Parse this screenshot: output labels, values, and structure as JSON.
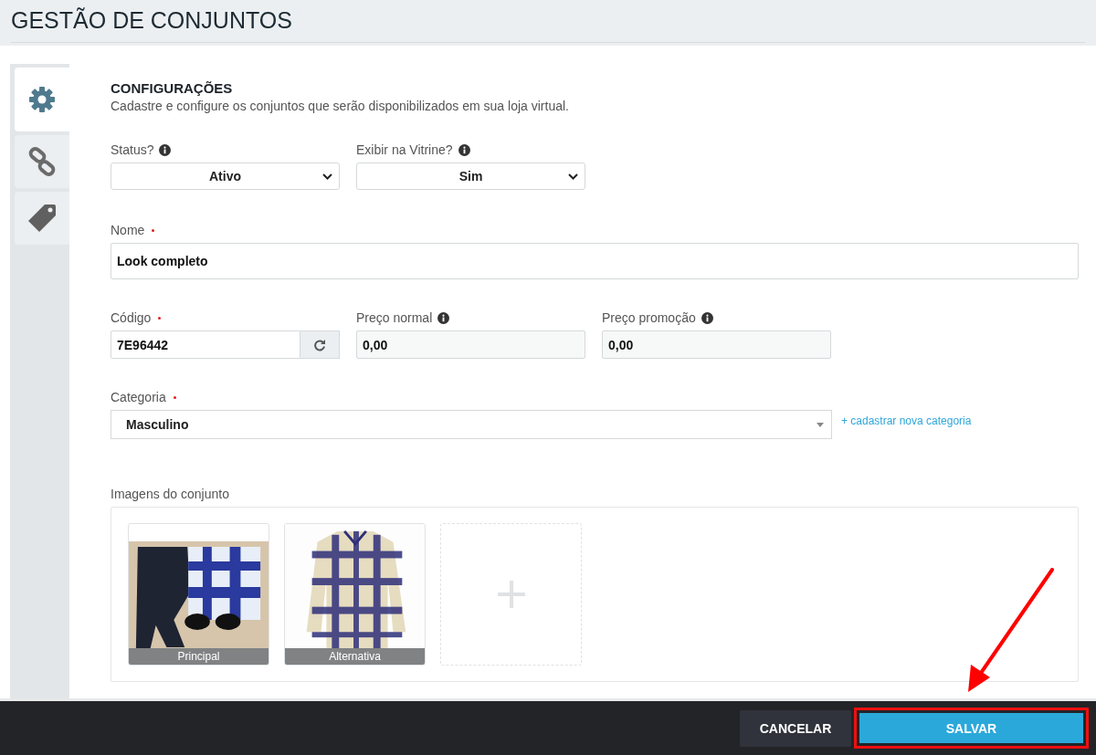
{
  "page_title": "GESTÃO DE CONJUNTOS",
  "sidebar": {
    "tabs": [
      {
        "kind": "gear",
        "selected": true
      },
      {
        "kind": "link",
        "selected": false
      },
      {
        "kind": "tag",
        "selected": false
      }
    ]
  },
  "section": {
    "title": "CONFIGURAÇÕES",
    "description": "Cadastre e configure os conjuntos que serão disponibilizados em sua loja virtual."
  },
  "status": {
    "label": "Status?",
    "value": "Ativo"
  },
  "vitrine": {
    "label": "Exibir na Vitrine?",
    "value": "Sim"
  },
  "nome": {
    "label": "Nome",
    "required": true,
    "value": "Look completo"
  },
  "codigo": {
    "label": "Código",
    "required": true,
    "value": "7E96442"
  },
  "preco_normal": {
    "label": "Preço normal",
    "value": "0,00"
  },
  "preco_promocao": {
    "label": "Preço promoção",
    "value": "0,00"
  },
  "categoria": {
    "label": "Categoria",
    "required": true,
    "value": "Masculino",
    "link": "+ cadastrar nova categoria"
  },
  "images": {
    "label": "Imagens do conjunto",
    "items": [
      {
        "kind": "outfit",
        "caption": "Principal"
      },
      {
        "kind": "shirt",
        "caption": "Alternativa"
      }
    ]
  },
  "footer": {
    "cancel": "CANCELAR",
    "save": "SALVAR",
    "save_highlighted": true
  }
}
